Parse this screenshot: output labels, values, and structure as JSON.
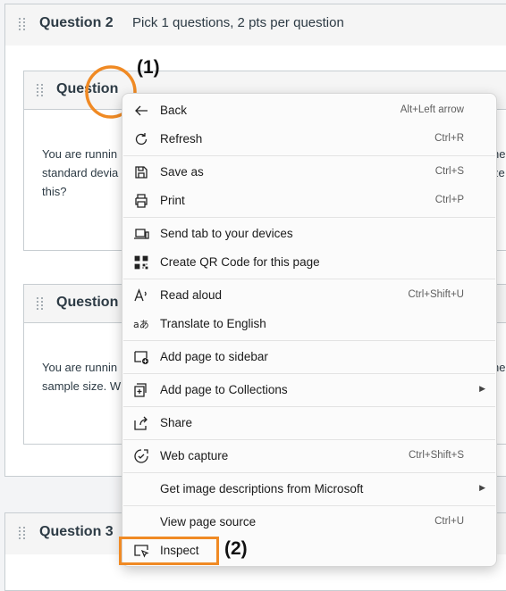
{
  "question_group_2": {
    "title": "Question 2",
    "subtitle": "Pick 1 questions, 2 pts per question"
  },
  "question_cards": [
    {
      "title": "Question",
      "text_lines_left": [
        "You are runnin",
        "standard devia",
        "this?"
      ],
      "text_lines_right": [
        "he",
        "ze"
      ]
    },
    {
      "title": "Question",
      "text_lines_left": [
        "You are runnin",
        "sample size. W"
      ],
      "text_lines_right": [
        "he"
      ]
    }
  ],
  "question_group_3": {
    "title": "Question 3"
  },
  "annotations": {
    "marker_1": "(1)",
    "marker_2": "(2)",
    "highlight_color": "#f08a24"
  },
  "context_menu": {
    "items": [
      {
        "icon": "back-arrow-icon",
        "label": "Back",
        "shortcut": "Alt+Left arrow"
      },
      {
        "icon": "refresh-icon",
        "label": "Refresh",
        "shortcut": "Ctrl+R"
      },
      {
        "icon": "save-icon",
        "label": "Save as",
        "shortcut": "Ctrl+S"
      },
      {
        "icon": "print-icon",
        "label": "Print",
        "shortcut": "Ctrl+P"
      },
      {
        "icon": "send-tab-icon",
        "label": "Send tab to your devices",
        "shortcut": ""
      },
      {
        "icon": "qr-code-icon",
        "label": "Create QR Code for this page",
        "shortcut": ""
      },
      {
        "icon": "read-aloud-icon",
        "label": "Read aloud",
        "shortcut": "Ctrl+Shift+U"
      },
      {
        "icon": "translate-icon",
        "label": "Translate to English",
        "shortcut": ""
      },
      {
        "icon": "sidebar-add-icon",
        "label": "Add page to sidebar",
        "shortcut": ""
      },
      {
        "icon": "collections-icon",
        "label": "Add page to Collections",
        "shortcut": ""
      },
      {
        "icon": "share-icon",
        "label": "Share",
        "shortcut": ""
      },
      {
        "icon": "web-capture-icon",
        "label": "Web capture",
        "shortcut": "Ctrl+Shift+S"
      },
      {
        "icon": "",
        "label": "Get image descriptions from Microsoft",
        "shortcut": ""
      },
      {
        "icon": "",
        "label": "View page source",
        "shortcut": "Ctrl+U"
      },
      {
        "icon": "inspect-icon",
        "label": "Inspect",
        "shortcut": ""
      }
    ]
  }
}
